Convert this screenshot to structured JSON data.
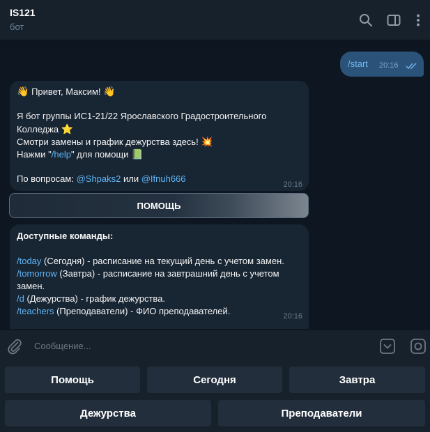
{
  "header": {
    "title": "IS121",
    "subtitle": "бот"
  },
  "messages": {
    "outgoing": {
      "text": "/start",
      "time": "20:16"
    },
    "greeting": {
      "line1_text": "Привет, Максим!",
      "line1_emoji": "👋",
      "line3": "Я бот группы ИС1-21/22 Ярославского Градостроительного",
      "line4_text": "Колледжа",
      "line4_emoji": "⭐",
      "line5_text": "Смотри замены и график дежурства здесь!",
      "line5_emoji": "💥",
      "line6_prefix": "Нажми \"",
      "line6_link": "/help",
      "line6_suffix": "\" для помощи",
      "line6_emoji": "📗",
      "line8_prefix": "По вопросам: ",
      "line8_link1": "@Shpaks2",
      "line8_mid": " или ",
      "line8_link2": "@Ifnuh666",
      "time": "20:16"
    },
    "inline_button": "ПОМОЩЬ",
    "commands": {
      "title": "Доступные команды:",
      "today_cmd": "/today",
      "today_desc": " (Сегодня) - расписание на текущий день с учетом замен.",
      "tomorrow_cmd": "/tomorrow",
      "tomorrow_desc": " (Завтра) - расписание на завтрашний день с учетом",
      "tomorrow_desc2": "замен.",
      "d_cmd": "/d",
      "d_desc": " (Дежурства) - график дежурства.",
      "teachers_cmd": "/teachers",
      "teachers_desc": " (Преподаватели) - ФИО преподавателей.",
      "time": "20:16"
    }
  },
  "input": {
    "placeholder": "Сообщение..."
  },
  "keyboard": {
    "row1": [
      "Помощь",
      "Сегодня",
      "Завтра"
    ],
    "row2": [
      "Дежурства",
      "Преподаватели"
    ]
  },
  "icons": {
    "search": "search-icon",
    "sidebar": "sidebar-toggle-icon",
    "more": "more-vertical-icon",
    "attach": "paperclip-icon",
    "keyboard": "keyboard-toggle-icon",
    "camera": "camera-icon"
  },
  "colors": {
    "background": "#0e1621",
    "panel": "#17212b",
    "incoming_bubble": "#182533",
    "outgoing_bubble": "#2b5278",
    "link": "#5eb5f7",
    "keyboard_button": "#232e3c"
  }
}
